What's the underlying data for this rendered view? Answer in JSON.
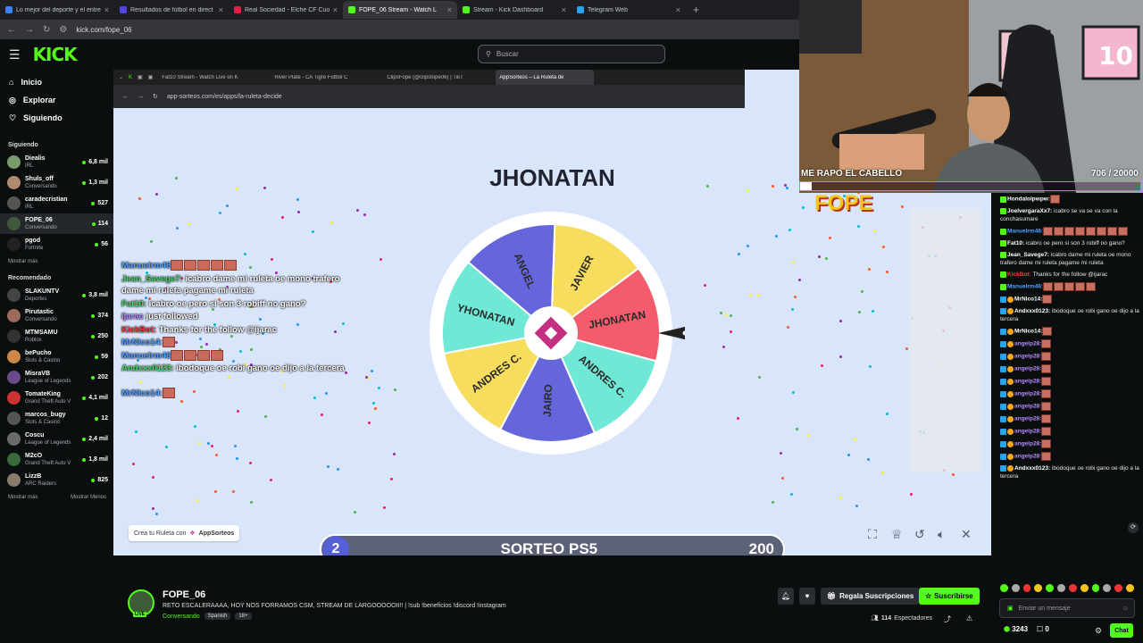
{
  "browser": {
    "tabs": [
      {
        "label": "Lo mejor del deporte y el entre",
        "color": "#3b82f6",
        "active": false
      },
      {
        "label": "Resultados de fútbol en direct",
        "color": "#4f46e5",
        "active": false
      },
      {
        "label": "Real Sociedad - Elche CF Cuota",
        "color": "#e11d48",
        "active": false
      },
      {
        "label": "FOPE_06 Stream - Watch L",
        "color": "#53fc18",
        "active": true
      },
      {
        "label": "Stream - Kick Dashboard",
        "color": "#53fc18",
        "active": false
      },
      {
        "label": "Telegram Web",
        "color": "#2aa3ef",
        "active": false
      }
    ],
    "url": "kick.com/fope_06"
  },
  "header": {
    "logo": "KICK",
    "search_placeholder": "Buscar"
  },
  "sidebar": {
    "nav": [
      {
        "label": "Inicio",
        "icon": "home-icon"
      },
      {
        "label": "Explorar",
        "icon": "compass-icon"
      },
      {
        "label": "Siguiendo",
        "icon": "heart-icon"
      }
    ],
    "following_title": "Siguiendo",
    "following": [
      {
        "name": "Diealis",
        "category": "IRL",
        "viewers": "6,8 mil",
        "color": "#7a9b6a"
      },
      {
        "name": "Shuls_off",
        "category": "Conversando",
        "viewers": "1,3 mil",
        "color": "#b08a6e"
      },
      {
        "name": "caradecristian",
        "category": "IRL",
        "viewers": "527",
        "color": "#555"
      },
      {
        "name": "FOPE_06",
        "category": "Conversando",
        "viewers": "114",
        "color": "#3f5a3a",
        "selected": true
      },
      {
        "name": "pgod",
        "category": "Fortnite",
        "viewers": "56",
        "color": "#222"
      }
    ],
    "show_more": "Mostrar más",
    "recommended_title": "Recomendado",
    "recommended": [
      {
        "name": "SLAKUNTV",
        "category": "Deportes",
        "viewers": "3,8 mil",
        "color": "#444"
      },
      {
        "name": "Pirutastic",
        "category": "Conversando",
        "viewers": "374",
        "color": "#9b6a5a"
      },
      {
        "name": "MTMSAMU",
        "category": "Roblox",
        "viewers": "250",
        "color": "#333"
      },
      {
        "name": "bePucho",
        "category": "Slots & Casino",
        "viewers": "59",
        "color": "#c84"
      },
      {
        "name": "MisraVB",
        "category": "League of Legends",
        "viewers": "202",
        "color": "#6a4a8a"
      },
      {
        "name": "TomateKing",
        "category": "Grand Theft Auto V",
        "viewers": "4,1 mil",
        "color": "#c33"
      },
      {
        "name": "marcos_bugy",
        "category": "Slots & Casino",
        "viewers": "12",
        "color": "#555"
      },
      {
        "name": "Coscu",
        "category": "League of Legends",
        "viewers": "2,4 mil",
        "color": "#6a6a6a"
      },
      {
        "name": "M2cO",
        "category": "Grand Theft Auto V",
        "viewers": "1,8 mil",
        "color": "#3a6a3a"
      },
      {
        "name": "LizzB",
        "category": "ARC Raiders",
        "viewers": "825",
        "color": "#8a7a6a"
      }
    ],
    "show_more_2": "Mostrar más",
    "show_less": "Mostrar Menos"
  },
  "inner_browser": {
    "tabs": [
      "Fat10 Stream - Watch Live on K",
      "River Plate - CA Tigre Fútbol C",
      "ClipsFope (@clipsfope06) | TikT",
      "AppSorteos – La Ruleta de"
    ],
    "url": "app-sorteos.com/es/apps/la-ruleta-decide"
  },
  "wheel": {
    "winner": "JHONATAN",
    "segments": [
      {
        "label": "JAVIER",
        "color": "#f6dd5e"
      },
      {
        "label": "JHONATAN",
        "color": "#f25c6d"
      },
      {
        "label": "ANDRES C.",
        "color": "#6fe8d6"
      },
      {
        "label": "JAIRO",
        "color": "#6566db"
      },
      {
        "label": "ANDRES C.",
        "color": "#f6dd5e"
      },
      {
        "label": "YHONATAN",
        "color": "#6fe8d6"
      },
      {
        "label": "ANGEL",
        "color": "#6566db"
      }
    ],
    "branding": "Crea tu Ruleta con",
    "brand_name": "AppSorteos"
  },
  "overlay_chat": [
    {
      "user": "Manuelrm46",
      "text": "",
      "user_color": "#4fa0ff",
      "emotes": 5
    },
    {
      "user": "Jean_Savege7:",
      "text": "icabro dame mi ruleta oe mono trafero dame mi ruleta pagame mi ruleta",
      "user_color": "#4cd66a",
      "emotes": 0
    },
    {
      "user": "Fat10:",
      "text": "icabro oe pero si son 3 robiff no gano?",
      "user_color": "#4cd66a",
      "emotes": 0
    },
    {
      "user": "ijarac",
      "text": "just followed",
      "user_color": "#b58aff",
      "emotes": 0
    },
    {
      "user": "KickBot:",
      "text": "Thanks for the follow @ijarac",
      "user_color": "#ff3b3b",
      "emotes": 0
    },
    {
      "user": "MrNico14:",
      "text": "",
      "user_color": "#4fa0ff",
      "emotes": 1
    },
    {
      "user": "Manuelrm46",
      "text": "",
      "user_color": "#4fa0ff",
      "emotes": 4
    },
    {
      "user": "Andxxx0123:",
      "text": "ibodoque oe robi gano oe dijo a la tercera",
      "user_color": "#4cd66a",
      "emotes": 0
    },
    {
      "user": "MrNico14:",
      "text": "",
      "user_color": "#4fa0ff",
      "emotes": 1
    }
  ],
  "sorteo": {
    "number": "2",
    "label": "SORTEO PS5",
    "count": "200"
  },
  "webcam": {
    "label": "ME RAPO EL CABELLO",
    "counter": "706 / 20000",
    "progress": 0.035,
    "banner": "FOPE"
  },
  "chat": [
    {
      "user": "Hondalolpwpw:",
      "text": "",
      "color": "#ffffff",
      "emotes": 1
    },
    {
      "user": "JoelvergaraXx7:",
      "text": "icabro se va se va con la conchasumare",
      "color": "#ffffff",
      "emotes": 0
    },
    {
      "user": "Manuelrm46:",
      "text": "",
      "color": "#4fa0ff",
      "emotes": 8
    },
    {
      "user": "Fat10:",
      "text": "icabro oe pero si son 3 robiff no gano?",
      "color": "#ffffff",
      "emotes": 0
    },
    {
      "user": "Jean_Savege7:",
      "text": "icabro dame mi ruleta oe mono trafero dame mi ruleta pagame mi ruleta",
      "color": "#ffffff",
      "emotes": 0
    },
    {
      "user": "KickBot:",
      "text": "Thanks for the follow @ijarac",
      "color": "#ff3b3b",
      "emotes": 0
    },
    {
      "user": "Manuelrm46:",
      "text": "",
      "color": "#4fa0ff",
      "emotes": 5
    },
    {
      "user": "MrNico14:",
      "text": "",
      "color": "#ffffff",
      "emotes": 1
    },
    {
      "user": "Andxxx0123:",
      "text": "ibodoque oe robi gano oe dijo a la tercera",
      "color": "#ffffff",
      "emotes": 0
    },
    {
      "user": "MrNico14:",
      "text": "",
      "color": "#ffffff",
      "emotes": 1
    },
    {
      "user": "angelp28:",
      "text": "",
      "color": "#b58aff",
      "emotes": 1
    },
    {
      "user": "angelp28:",
      "text": "",
      "color": "#b58aff",
      "emotes": 1
    },
    {
      "user": "angelp28:",
      "text": "",
      "color": "#b58aff",
      "emotes": 1
    },
    {
      "user": "angelp28:",
      "text": "",
      "color": "#b58aff",
      "emotes": 1
    },
    {
      "user": "angelp28:",
      "text": "",
      "color": "#b58aff",
      "emotes": 1
    },
    {
      "user": "angelp28:",
      "text": "",
      "color": "#b58aff",
      "emotes": 1
    },
    {
      "user": "angelp28:",
      "text": "",
      "color": "#b58aff",
      "emotes": 1
    },
    {
      "user": "angelp28:",
      "text": "",
      "color": "#b58aff",
      "emotes": 1
    },
    {
      "user": "angelp28:",
      "text": "",
      "color": "#b58aff",
      "emotes": 1
    },
    {
      "user": "angelp28:",
      "text": "",
      "color": "#b58aff",
      "emotes": 1
    },
    {
      "user": "Andxxx0123:",
      "text": "ibodoque oe robi gano oe dijo a la tercera",
      "color": "#ffffff",
      "emotes": 0
    }
  ],
  "chat_input_placeholder": "Enviar un mensaje",
  "chat_button": "Chat",
  "points": "3243",
  "points2": "0",
  "channel": {
    "name": "FOPE_06",
    "live": "LIVE",
    "title": "RETO ESCALERAAAA, HOY NOS FORRAMOS CSM, STREAM DE LARGOOOOOII!! | !sub !beneficios !discord !instagram",
    "category": "Conversando",
    "language": "Spanish",
    "rating": "18+",
    "gift_button": "Regala Suscripciones",
    "subscribe_button": "Suscribirse",
    "viewers": "114",
    "viewers_label": "Espectadores"
  },
  "colors": {
    "kick_green": "#53fc18",
    "bg": "#0b0e0f"
  }
}
